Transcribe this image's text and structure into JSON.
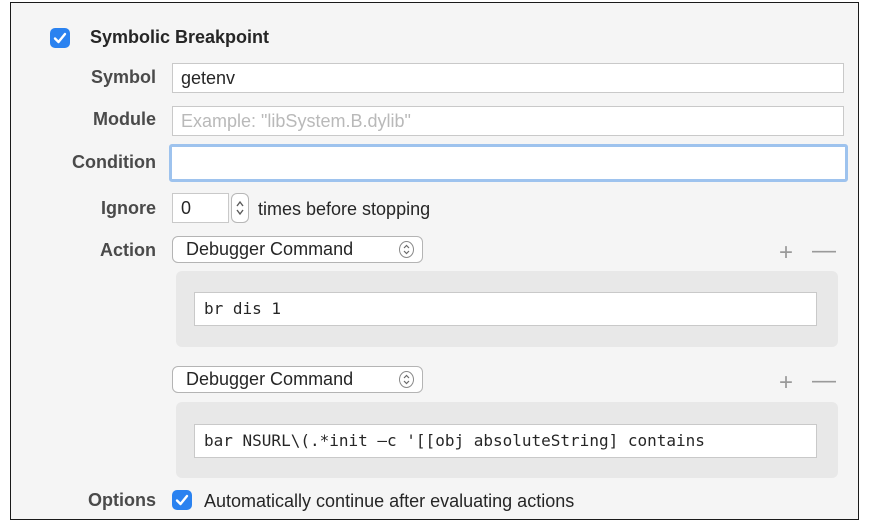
{
  "breakpoint": {
    "enabled": true,
    "title": "Symbolic Breakpoint"
  },
  "symbol": {
    "label": "Symbol",
    "value": "getenv"
  },
  "module": {
    "label": "Module",
    "placeholder": "Example: \"libSystem.B.dylib\""
  },
  "condition": {
    "label": "Condition",
    "value": ""
  },
  "ignore": {
    "label": "Ignore",
    "value": "0",
    "suffix": "times before stopping"
  },
  "action": {
    "label": "Action"
  },
  "actions": [
    {
      "type": "Debugger Command",
      "command": "br dis 1",
      "add": "+",
      "remove": "—"
    },
    {
      "type": "Debugger Command",
      "command": "bar NSURL\\(.*init —c '[[obj absoluteString] contains",
      "add": "+",
      "remove": "—"
    }
  ],
  "options": {
    "label": "Options",
    "auto_continue_checked": true,
    "auto_continue_label": "Automatically continue after evaluating actions"
  },
  "colors": {
    "accent": "#2a82f0",
    "focus_ring": "#9ec3ee",
    "background": "#f5f5f5"
  },
  "icons": {
    "enable_checkbox": "checkmark-icon",
    "stepper": "stepper-icon",
    "popup": "chevron-updown-icon"
  }
}
